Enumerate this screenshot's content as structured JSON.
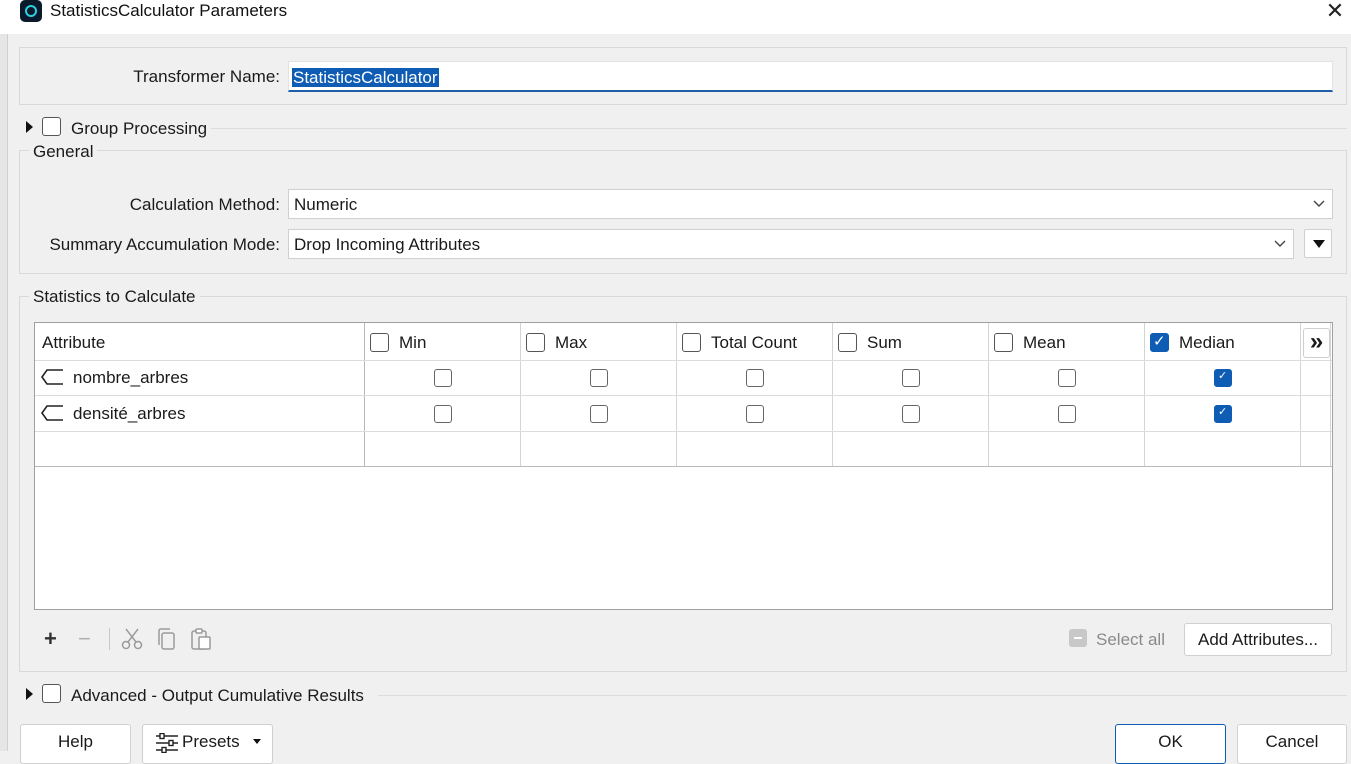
{
  "window": {
    "title": "StatisticsCalculator Parameters",
    "close_glyph": "✕"
  },
  "transformer": {
    "label": "Transformer Name:",
    "value": "StatisticsCalculator"
  },
  "group_processing": {
    "label": "Group Processing",
    "checked": false
  },
  "general": {
    "heading": "General",
    "calc_method": {
      "label": "Calculation Method:",
      "value": "Numeric"
    },
    "summary_mode": {
      "label": "Summary Accumulation Mode:",
      "value": "Drop Incoming Attributes"
    }
  },
  "stats": {
    "heading": "Statistics to Calculate",
    "columns": [
      {
        "label": "Attribute"
      },
      {
        "label": "Min",
        "checked": false
      },
      {
        "label": "Max",
        "checked": false
      },
      {
        "label": "Total Count",
        "checked": false
      },
      {
        "label": "Sum",
        "checked": false
      },
      {
        "label": "Mean",
        "checked": false
      },
      {
        "label": "Median",
        "checked": true
      }
    ],
    "more_columns_glyph": "»",
    "rows": [
      {
        "attribute": "nombre_arbres",
        "min": false,
        "max": false,
        "total_count": false,
        "sum": false,
        "mean": false,
        "median": true
      },
      {
        "attribute": "densité_arbres",
        "min": false,
        "max": false,
        "total_count": false,
        "sum": false,
        "mean": false,
        "median": true
      }
    ],
    "toolbar": {
      "add": "+",
      "remove": "−"
    },
    "select_all": "Select all",
    "add_attributes": "Add Attributes..."
  },
  "advanced": {
    "label": "Advanced - Output Cumulative Results",
    "checked": false
  },
  "footer": {
    "help": "Help",
    "presets": "Presets",
    "ok": "OK",
    "cancel": "Cancel"
  },
  "colors": {
    "accent": "#0e5cb3"
  }
}
